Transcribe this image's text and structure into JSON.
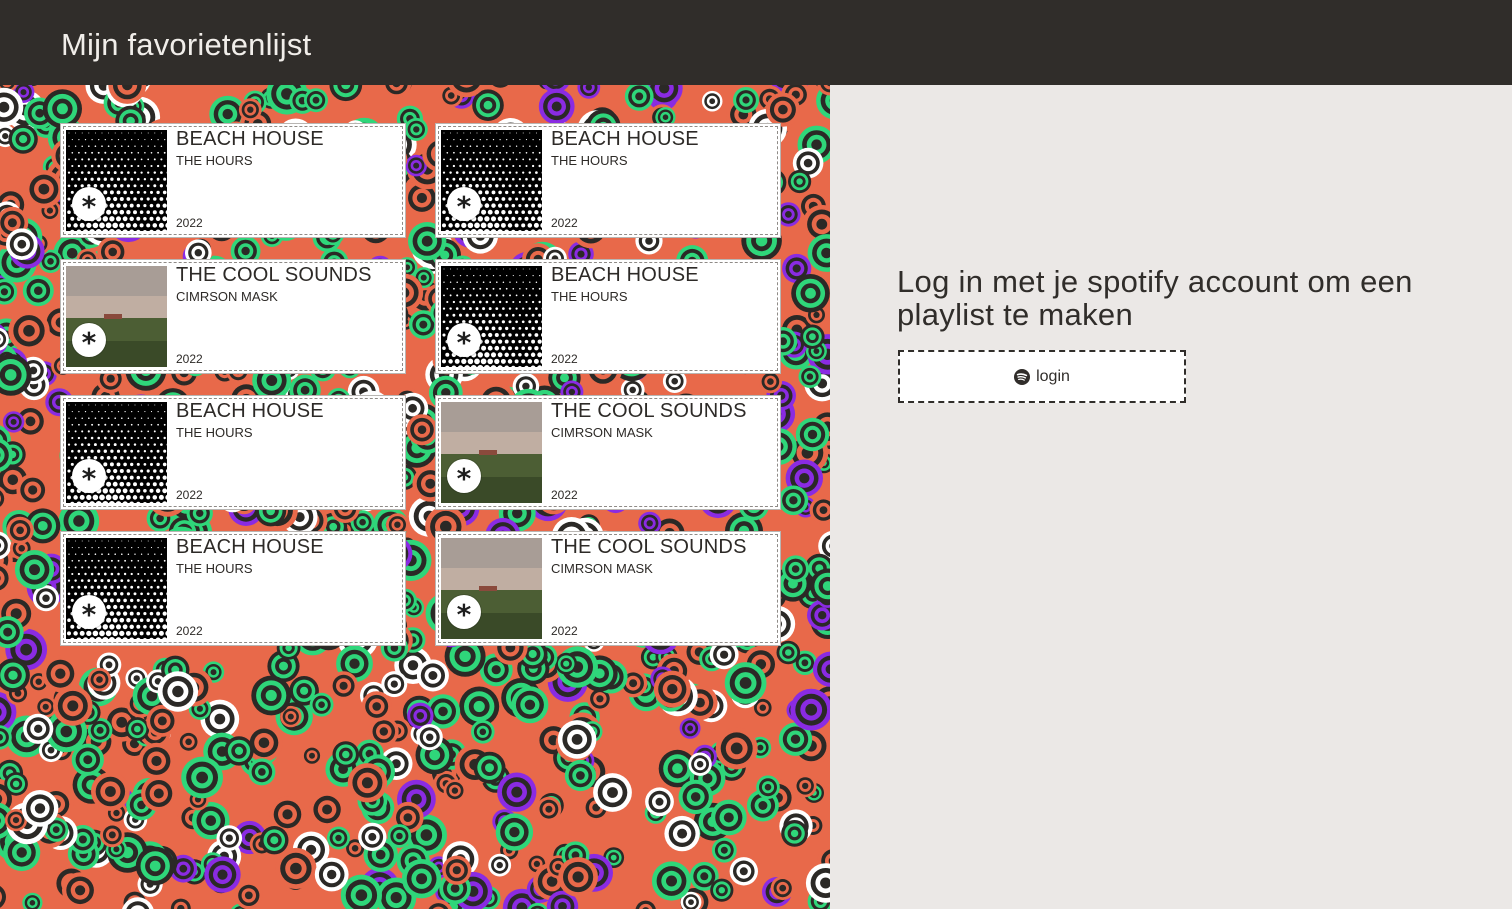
{
  "header": {
    "title": "Mijn favorietenlijst"
  },
  "favorites": [
    {
      "title": "BEACH HOUSE",
      "artist": "THE HOURS",
      "year": "2022",
      "cover": "halftone-dots",
      "icon": "star-icon"
    },
    {
      "title": "BEACH HOUSE",
      "artist": "THE HOURS",
      "year": "2022",
      "cover": "halftone-dots",
      "icon": "star-icon"
    },
    {
      "title": "THE COOL SOUNDS",
      "artist": "CIMRSON MASK",
      "year": "2022",
      "cover": "field-photo",
      "icon": "star-icon"
    },
    {
      "title": "BEACH HOUSE",
      "artist": "THE HOURS",
      "year": "2022",
      "cover": "halftone-dots",
      "icon": "star-icon"
    },
    {
      "title": "BEACH HOUSE",
      "artist": "THE HOURS",
      "year": "2022",
      "cover": "halftone-dots",
      "icon": "star-icon"
    },
    {
      "title": "THE COOL SOUNDS",
      "artist": "CIMRSON MASK",
      "year": "2022",
      "cover": "field-photo",
      "icon": "star-icon"
    },
    {
      "title": "BEACH HOUSE",
      "artist": "THE HOURS",
      "year": "2022",
      "cover": "halftone-dots",
      "icon": "star-icon"
    },
    {
      "title": "THE COOL SOUNDS",
      "artist": "CIMRSON MASK",
      "year": "2022",
      "cover": "field-photo",
      "icon": "star-icon"
    }
  ],
  "login": {
    "heading": "Log in met je spotify account om een playlist te maken",
    "button_label": "login",
    "button_icon": "spotify-icon"
  },
  "colors": {
    "header_bg": "#302d2a",
    "page_bg": "#ebe8e6",
    "pattern_green": "#2fd67a",
    "pattern_orange": "#e8694a",
    "pattern_purple": "#8a2be2",
    "pattern_dark": "#2b2926"
  }
}
